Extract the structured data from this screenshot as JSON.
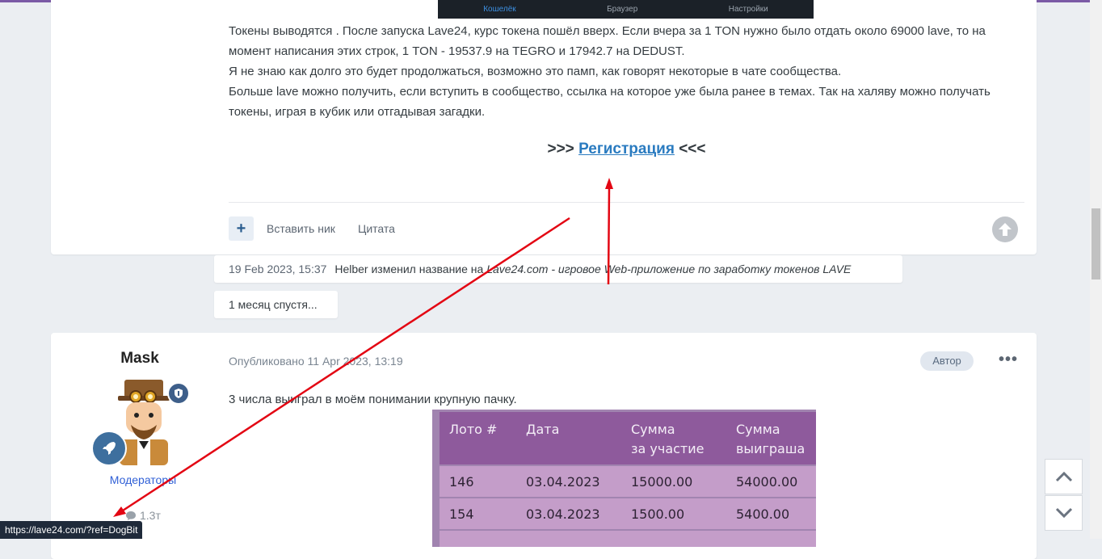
{
  "app_bar": {
    "items": [
      "Кошелёк",
      "Браузер",
      "Настройки"
    ]
  },
  "post1": {
    "paragraphs": [
      "Токены выводятся . После запуска Lave24, курс токена пошёл вверх. Если вчера за 1 TON нужно было отдать около 69000 lave, то на момент написания этих строк, 1 TON - 19537.9 на TEGRO и 17942.7 на DEDUST.",
      "Я не знаю как долго это будет продолжаться, возможно это памп, как говорят некоторые в чате сообщества.",
      "Больше lave можно получить, если вступить в сообщество, ссылка на которое уже была ранее в темах. Так на халяву можно получать токены, играя в кубик или отгадывая загадки."
    ],
    "reg_prefix": ">>> ",
    "reg_link": "Регистрация",
    "reg_suffix": " <<<",
    "plus_label": "+",
    "insert_nick": "Вставить ник",
    "quote": "Цитата"
  },
  "event": {
    "timestamp": "19 Feb 2023, 15:37",
    "text": "Helber изменил название на",
    "title": "Lave24.com - игровое Web-приложение по заработку токенов LAVE"
  },
  "time_gap": "1 месяц спустя...",
  "post2": {
    "author": "Mask",
    "group": "Модераторы",
    "post_count": "1.3т",
    "posted": "Опубликовано 11 Apr 2023, 13:19",
    "author_badge": "Автор",
    "more": "•••",
    "text": "3 числа выиграл в моём понимании крупную пачку.",
    "table": {
      "headers": [
        "Лото #",
        "Дата",
        "Сумма\nза участие",
        "Сумма\nвыиграша"
      ],
      "rows": [
        [
          "146",
          "03.04.2023",
          "15000.00",
          "54000.00"
        ],
        [
          "154",
          "03.04.2023",
          "1500.00",
          "5400.00"
        ]
      ]
    }
  },
  "status_url": "https://lave24.com/?ref=DogBit",
  "colors": {
    "link": "#2a7bc0",
    "annotation_arrow": "#e30613",
    "table_header": "#8e5a9c",
    "table_cell": "#c49dc9"
  }
}
